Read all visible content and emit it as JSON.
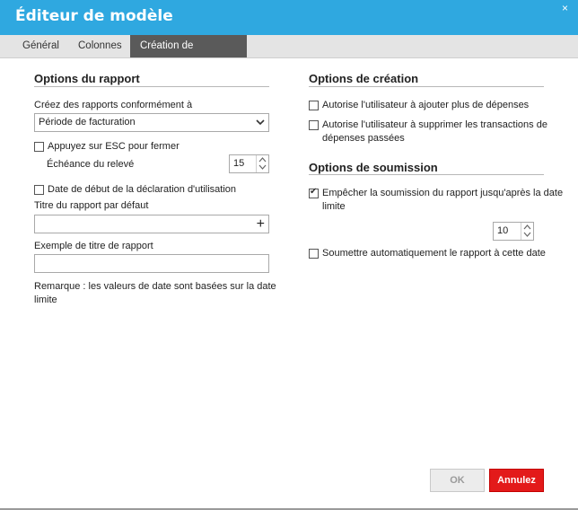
{
  "window": {
    "title": "Éditeur de modèle",
    "close_glyph": "×"
  },
  "tabs": [
    {
      "label": "Général"
    },
    {
      "label": "Colonnes"
    },
    {
      "label": "Création de dépenses"
    }
  ],
  "left": {
    "report_options_title": "Options du rapport",
    "create_reports_label": "Créez des rapports conformément à",
    "create_reports_value": "Période de facturation",
    "esc_close_label": "Appuyez sur ESC pour fermer",
    "esc_close_checked": false,
    "statement_due_label": "Échéance du relevé",
    "statement_due_value": "15",
    "usage_start_date_label": "Date de début de la déclaration d'utilisation",
    "usage_start_date_checked": false,
    "default_title_label": "Titre du rapport par défaut",
    "default_title_value": "",
    "add_icon_glyph": "+",
    "example_title_label": "Exemple de titre de rapport",
    "example_title_value": "",
    "note": "Remarque : les valeurs de date sont basées sur la date limite"
  },
  "right": {
    "creation_options_title": "Options de création",
    "allow_add_label": "Autorise l'utilisateur à ajouter plus de dépenses",
    "allow_add_checked": false,
    "allow_delete_label": "Autorise l'utilisateur à supprimer les transactions de dépenses passées",
    "allow_delete_checked": false,
    "submission_options_title": "Options de soumission",
    "prevent_submit_label": "Empêcher la soumission du rapport jusqu'après la date limite",
    "prevent_submit_checked": true,
    "prevent_days_value": "10",
    "auto_submit_label": "Soumettre automatiquement le rapport à cette date",
    "auto_submit_checked": false
  },
  "footer": {
    "ok_label": "OK",
    "cancel_label": "Annulez"
  },
  "colors": {
    "titlebar": "#2fa8e0",
    "active_tab": "#5a5a5a",
    "cancel": "#e31a1a"
  }
}
